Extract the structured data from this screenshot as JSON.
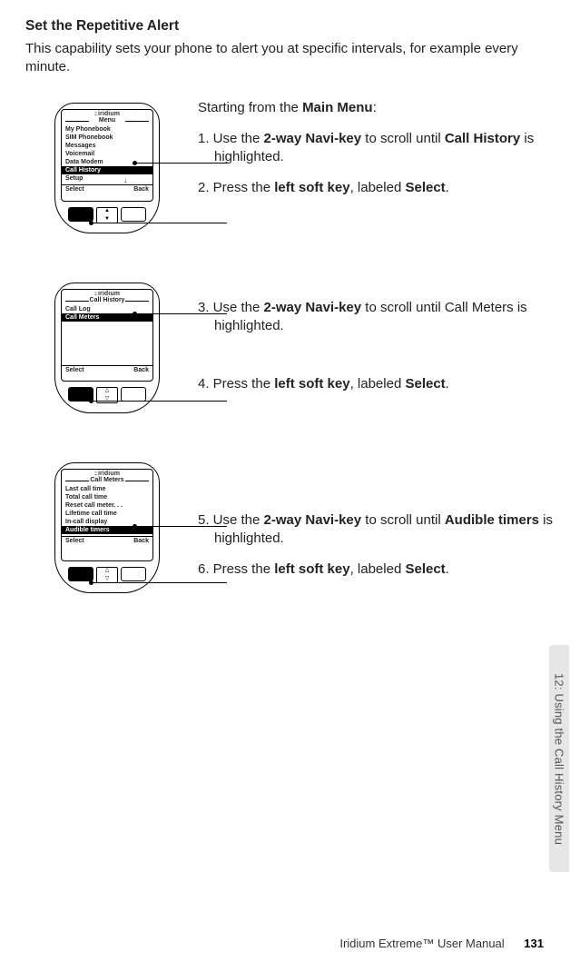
{
  "section_title": "Set the Repetitive Alert",
  "intro": "This capability sets your phone to alert you at specific intervals, for example every minute.",
  "brand": "iridium",
  "footer_product": "Iridium Extreme™ User Manual",
  "footer_page": "131",
  "side_tab": "12: Using the Call History Menu",
  "phones": {
    "p1": {
      "menu_title": "Menu",
      "items": [
        "My Phonebook",
        "SIM Phonebook",
        "Messages",
        "Voicemail",
        "Data Modem",
        "Call History",
        "Setup"
      ],
      "selected_index": 5,
      "soft_left": "Select",
      "soft_right": "Back",
      "show_down_arrow": true
    },
    "p2": {
      "menu_title": "Call History",
      "items": [
        "Call Log",
        "Call Meters"
      ],
      "selected_index": 1,
      "soft_left": "Select",
      "soft_right": "Back",
      "show_down_arrow": false
    },
    "p3": {
      "menu_title": "Call Meters",
      "items": [
        "Last call time",
        "Total call time",
        "Reset call meter. . .",
        "Lifetime call time",
        "In-call display",
        "Audible timers"
      ],
      "selected_index": 5,
      "soft_left": "Select",
      "soft_right": "Back",
      "show_down_arrow": false
    }
  },
  "text": {
    "b1_lead_pre": "Starting from the ",
    "b1_lead_bold": "Main Menu",
    "b1_lead_post": ":",
    "s1_pre": "1. Use the ",
    "s1_b1": "2-way Navi-key",
    "s1_mid": " to scroll until ",
    "s1_b2": "Call History",
    "s1_post": " is highlighted.",
    "s2_pre": "2. Press the ",
    "s2_b1": "left soft key",
    "s2_mid": ", labeled ",
    "s2_b2": "Select",
    "s2_post": ".",
    "s3_pre": "3. Use the ",
    "s3_b1": "2-way Navi-key",
    "s3_mid": " to scroll until Call Meters is highlighted.",
    "s4_pre": "4. Press the ",
    "s4_b1": "left soft key",
    "s4_mid": ", labeled ",
    "s4_b2": "Select",
    "s4_post": ".",
    "s5_pre": "5. Use the ",
    "s5_b1": "2-way Navi-key",
    "s5_mid": " to scroll until ",
    "s5_b2": "Audible timers",
    "s5_post": " is highlighted.",
    "s6_pre": "6. Press the ",
    "s6_b1": "left soft key",
    "s6_mid": ", labeled ",
    "s6_b2": "Select",
    "s6_post": "."
  }
}
